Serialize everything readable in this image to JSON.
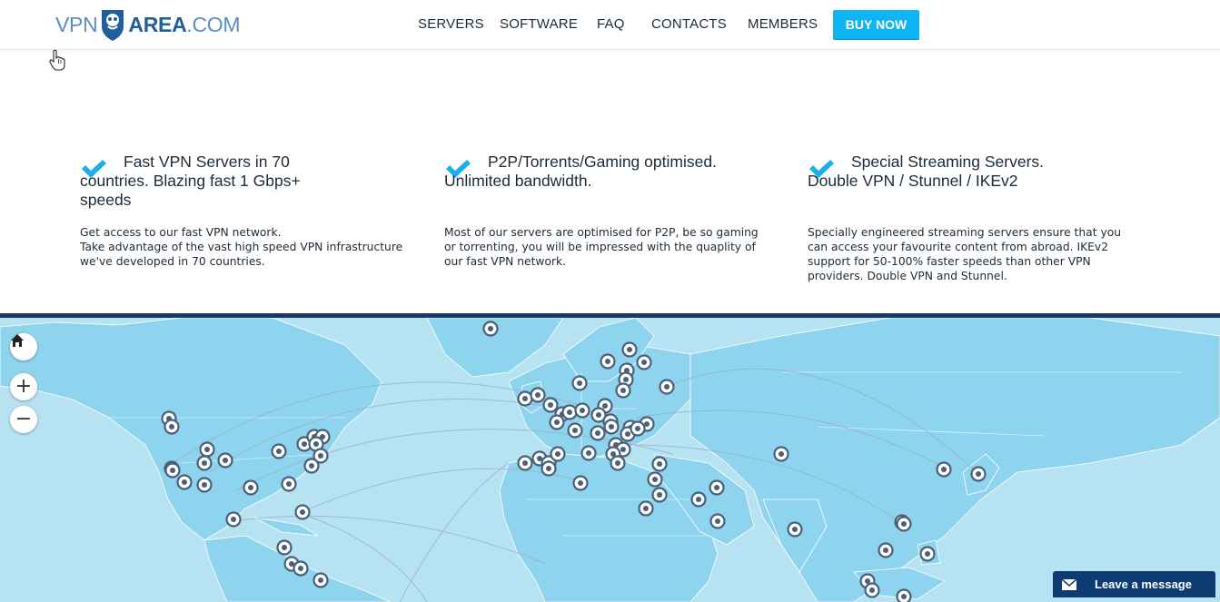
{
  "header": {
    "logo": {
      "vpn": "VPN",
      "area": "AREA",
      "dotcom": ".COM"
    },
    "nav": [
      {
        "label": "SERVERS"
      },
      {
        "label": "SOFTWARE"
      },
      {
        "label": "FAQ"
      },
      {
        "label": "CONTACTS"
      },
      {
        "label": "MEMBERS"
      }
    ],
    "buy_label": "BUY NOW"
  },
  "features": [
    {
      "title": "Fast VPN Servers in 70 countries. Blazing fast 1 Gbps+ speeds",
      "desc": "Get access to our fast VPN network.\nTake advantage of the vast high speed VPN infrastructure we've developed in 70 countries."
    },
    {
      "title": "P2P/Torrents/Gaming optimised. Unlimited bandwidth.",
      "desc": "Most of our servers are optimised for P2P, be so gaming or torrenting, you will be impressed with the quaplity of our fast VPN network."
    },
    {
      "title": "Special Streaming Servers. Double VPN / Stunnel / IKEv2",
      "desc": "Specially engineered streaming servers ensure that you can access your favourite content from abroad. IKEv2 support for 50-100% faster speeds than other VPN providers. Double VPN and Stunnel."
    }
  ],
  "map": {
    "controls": {
      "home": "home-icon",
      "zoom_in": "+",
      "zoom_out": "−"
    },
    "colors": {
      "ocean": "#b6e2f2",
      "land": "#8fd4ee",
      "marker": "#4a5f78",
      "border": "#1a3a63"
    }
  },
  "chat": {
    "label": "Leave a message"
  },
  "colors": {
    "accent": "#0fb4f2",
    "check": "#1aaeef",
    "chat_bg": "#0e3b72"
  }
}
